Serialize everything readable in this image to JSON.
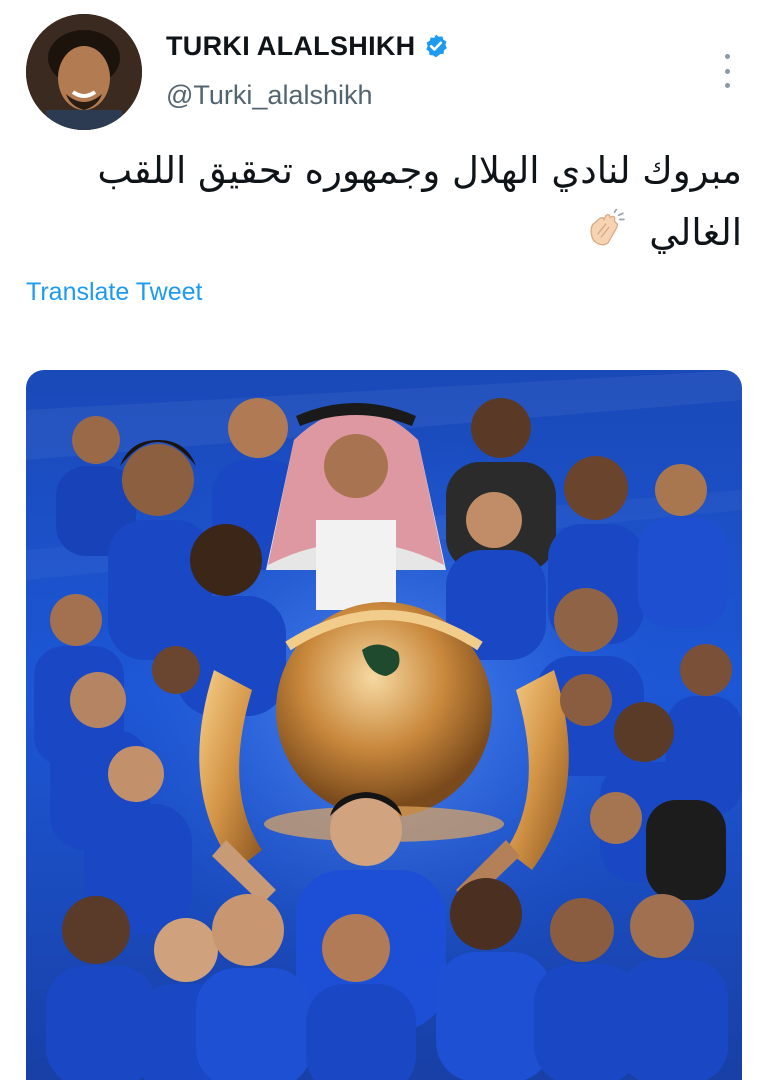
{
  "tweet": {
    "author": {
      "display_name": "TURKI ALALSHIKH",
      "handle": "@Turki_alalshikh",
      "verified": true,
      "avatar_icon": "profile-photo"
    },
    "text_line1": "مبروك لنادي الهلال وجمهوره تحقيق اللقب",
    "text_line2": "الغالي",
    "emoji": "clapping-hands",
    "translate_label": "Translate Tweet",
    "more_icon": "more-vertical-icon",
    "media": {
      "description_icon": "team-celebration-poster",
      "colors": {
        "background": "#1d57d6",
        "trophy": "#c9883c"
      }
    }
  },
  "colors": {
    "link": "#1d9bf0",
    "verified_badge": "#1d9bf0",
    "secondary_text": "#536471",
    "primary_text": "#0f1419"
  }
}
